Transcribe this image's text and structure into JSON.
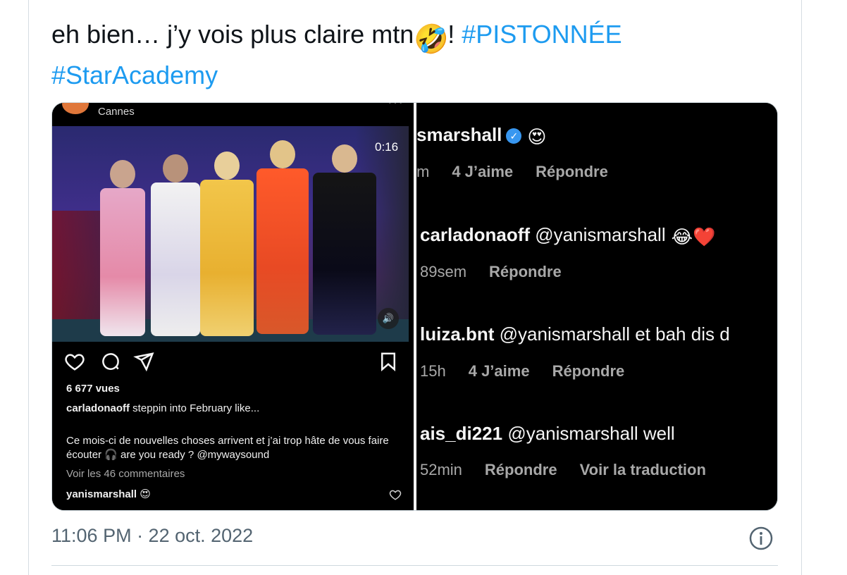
{
  "tweet": {
    "text_part1": "eh bien… j’y vois plus claire mtn",
    "emoji1": "🤣",
    "text_part2": "! ",
    "hashtag1": "#PISTONNÉE",
    "hashtag2": "#StarAcademy",
    "timestamp": "11:06 PM · 22 oct. 2022",
    "info_icon": "info-circle-icon"
  },
  "left_post": {
    "location": "Cannes",
    "video_time": "0:16",
    "views": "6 677 vues",
    "caption_user": "carladonaoff",
    "caption_text": " steppin into February like...",
    "description": "Ce mois-ci de nouvelles choses arrivent et j’ai trop hâte de vous faire écouter 🎧 are you ready ? @mywaysound",
    "comments_link": "Voir les 46 commentaires",
    "top_comment_user": "yanismarshall",
    "top_comment_emoji": "😍",
    "icons": [
      "heart-icon",
      "comment-icon",
      "share-icon",
      "bookmark-icon",
      "volume-icon"
    ]
  },
  "right_comments": {
    "c1": {
      "user": "smarshall",
      "emoji": "😍",
      "meta_time": "m",
      "likes": "4 J’aime",
      "reply": "Répondre"
    },
    "c2": {
      "user": "carladonaoff",
      "text": " @yanismarshall",
      "emoji": "😂❤️",
      "meta_time": "89sem",
      "reply": "Répondre"
    },
    "c3": {
      "user": "luiza.bnt",
      "text": " @yanismarshall et bah dis d",
      "meta_time": "15h",
      "likes": "4 J’aime",
      "reply": "Répondre"
    },
    "c4": {
      "user": "ais_di221",
      "text": " @yanismarshall well",
      "meta_time": "52min",
      "reply": "Répondre",
      "translate": "Voir la traduction"
    }
  },
  "colors": {
    "link": "#1d9bf0",
    "verified": "#3897f0",
    "muted": "#536471"
  }
}
